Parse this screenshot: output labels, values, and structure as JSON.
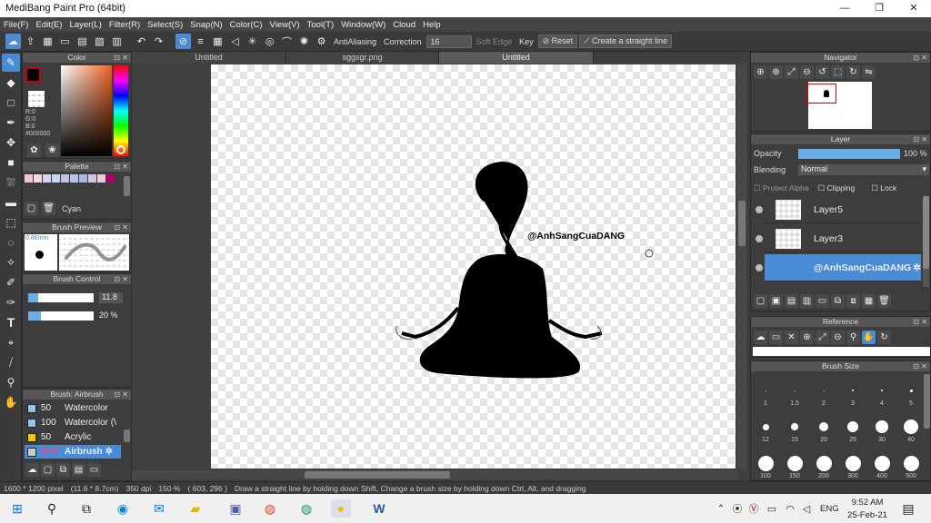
{
  "window": {
    "title": "MediBang Paint Pro (64bit)",
    "minimize": "—",
    "maximize": "❐",
    "close": "✕"
  },
  "menu": [
    "File(F)",
    "Edit(E)",
    "Layer(L)",
    "Filter(R)",
    "Select(S)",
    "Snap(N)",
    "Color(C)",
    "View(V)",
    "Tool(T)",
    "Window(W)",
    "Cloud",
    "Help"
  ],
  "toolbar": {
    "antialias": "AntiAliasing",
    "correction_label": "Correction",
    "correction_value": "16",
    "soft_edge": "Soft Edge",
    "key": "Key",
    "reset": "Reset",
    "straight_line": "Create a straight line"
  },
  "tabs": [
    "Untitled",
    "sggsgr.png",
    "Untitled"
  ],
  "color_panel": {
    "title": "Color",
    "r": "R:0",
    "g": "G:0",
    "b": "B:0",
    "hex": "#000000"
  },
  "palette_panel": {
    "title": "Palette",
    "color_name": "Cyan",
    "swatches": [
      "#f4c4d8",
      "#f7d6e4",
      "#d9d4ee",
      "#c8d8f0",
      "#c6c0e0",
      "#b8c4e8",
      "#a8b8e0",
      "#d0c8e0",
      "#f0c8d8",
      "#b0006a"
    ]
  },
  "brush_preview": {
    "title": "Brush Preview",
    "size_label": "0.86mm"
  },
  "brush_control": {
    "title": "Brush Control",
    "size_value": "11.8",
    "opacity_value": "20 %",
    "size_fill": 0.15,
    "opacity_fill": 0.2
  },
  "brush_panel": {
    "title": "Brush: Airbrush",
    "items": [
      {
        "size": "50",
        "name": "Watercolor",
        "color": "#8fc8ee"
      },
      {
        "size": "100",
        "name": "Watercolor (\\",
        "color": "#8fc8ee"
      },
      {
        "size": "50",
        "name": "Acrylic",
        "color": "#f0c800"
      },
      {
        "size": "11.8",
        "name": "Airbrush",
        "color": "#cccccc",
        "selected": true
      }
    ]
  },
  "navigator": {
    "title": "Navigator"
  },
  "layer_panel": {
    "title": "Layer",
    "opacity_label": "Opacity",
    "opacity_value": "100 %",
    "opacity_fill": 1.0,
    "blending_label": "Blending",
    "blending_value": "Normal",
    "protect_alpha": "Protect Alpha",
    "clipping": "Clipping",
    "lock": "Lock",
    "layers": [
      {
        "name": "Layer5",
        "selected": false
      },
      {
        "name": "Layer3",
        "selected": false
      },
      {
        "name": "@AnhSangCuaDANG",
        "selected": true
      }
    ]
  },
  "reference_panel": {
    "title": "Reference"
  },
  "brush_size_panel": {
    "title": "Brush Size",
    "row1": [
      "1",
      "1.5",
      "2",
      "3",
      "4",
      "5"
    ],
    "row2": [
      "12",
      "15",
      "20",
      "25",
      "30",
      "40"
    ],
    "row3": [
      "100",
      "150",
      "200",
      "300",
      "400",
      "500"
    ]
  },
  "canvas": {
    "watermark": "@AnhSangCuaDANG"
  },
  "status": {
    "pixels": "1600 * 1200 pixel",
    "size": "(11.6 * 8.7cm)",
    "dpi": "350 dpi",
    "zoom": "150 %",
    "coords": "( 603, 296 )",
    "hint": "Draw a straight line by holding down Shift, Change a brush size by holding down Ctrl, Alt, and dragging"
  },
  "taskbar": {
    "lang": "ENG",
    "time": "9:52 AM",
    "date": "25-Feb-21"
  }
}
